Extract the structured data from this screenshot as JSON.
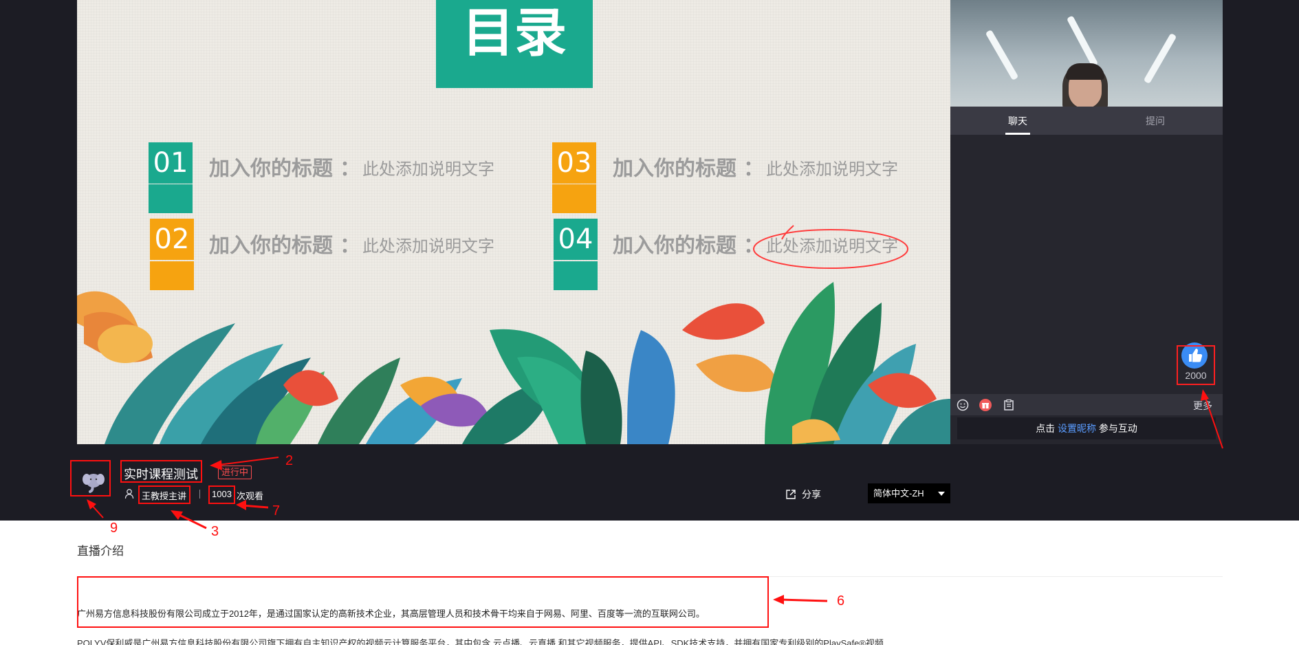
{
  "slide": {
    "title": "目录",
    "items": [
      {
        "num": "01",
        "heading": "加入你的标题",
        "sep": "：",
        "desc": "此处添加说明文字"
      },
      {
        "num": "02",
        "heading": "加入你的标题",
        "sep": "：",
        "desc": "此处添加说明文字"
      },
      {
        "num": "03",
        "heading": "加入你的标题",
        "sep": "：",
        "desc": "此处添加说明文字"
      },
      {
        "num": "04",
        "heading": "加入你的标题",
        "sep": "：",
        "desc": "此处添加说明文字"
      }
    ]
  },
  "chat": {
    "tabs": [
      {
        "label": "聊天",
        "active": true
      },
      {
        "label": "提问",
        "active": false
      }
    ],
    "like_count": "2000",
    "toolbar": {
      "icons": [
        "emoji-icon",
        "gift-icon",
        "notice-icon"
      ],
      "more_label": "更多"
    },
    "input": {
      "prefix": "点击 ",
      "link": "设置昵称",
      "suffix": " 参与互动"
    }
  },
  "course": {
    "title": "实时课程测试",
    "status": "进行中",
    "host": "王教授主讲",
    "view_count": "1003",
    "view_suffix": "次观看",
    "share_label": "分享",
    "language": "简体中文-ZH"
  },
  "intro": {
    "title": "直播介绍",
    "paragraph1": "广州易方信息科技股份有限公司成立于2012年，是通过国家认定的高新技术企业，其高层管理人员和技术骨干均来自于网易、阿里、百度等一流的互联网公司。",
    "paragraph2": "POLYV保利威是广州易方信息科技股份有限公司旗下拥有自主知识产权的视频云计算服务平台，其中包含 云点播、云直播 和其它视频服务，提供API、SDK技术支持，并拥有国家专利级别的PlaySafe®视频"
  },
  "annotations": [
    "2",
    "3",
    "6",
    "7",
    "9"
  ],
  "colors": {
    "accent_teal": "#1aa98e",
    "accent_orange": "#f6a310",
    "live_red": "#ff4d4f",
    "link_blue": "#5a9cff",
    "like_blue": "#3a8cf5",
    "annotation_red": "#ff1010"
  }
}
